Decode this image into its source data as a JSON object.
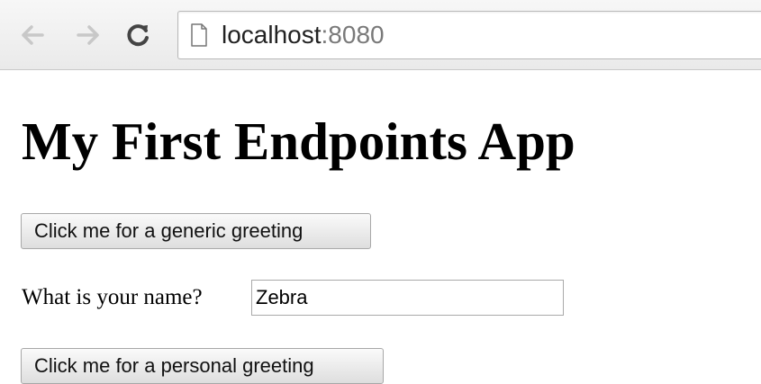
{
  "browser": {
    "url_host": "localhost",
    "url_port": ":8080",
    "nav_icons": [
      "back-arrow-icon",
      "forward-arrow-icon",
      "reload-icon",
      "page-icon"
    ]
  },
  "page": {
    "title": "My First Endpoints App",
    "generic_button_label": "Click me for a generic greeting",
    "name_label": "What is your name?",
    "name_value": "Zebra",
    "personal_button_label": "Click me for a personal greeting"
  }
}
